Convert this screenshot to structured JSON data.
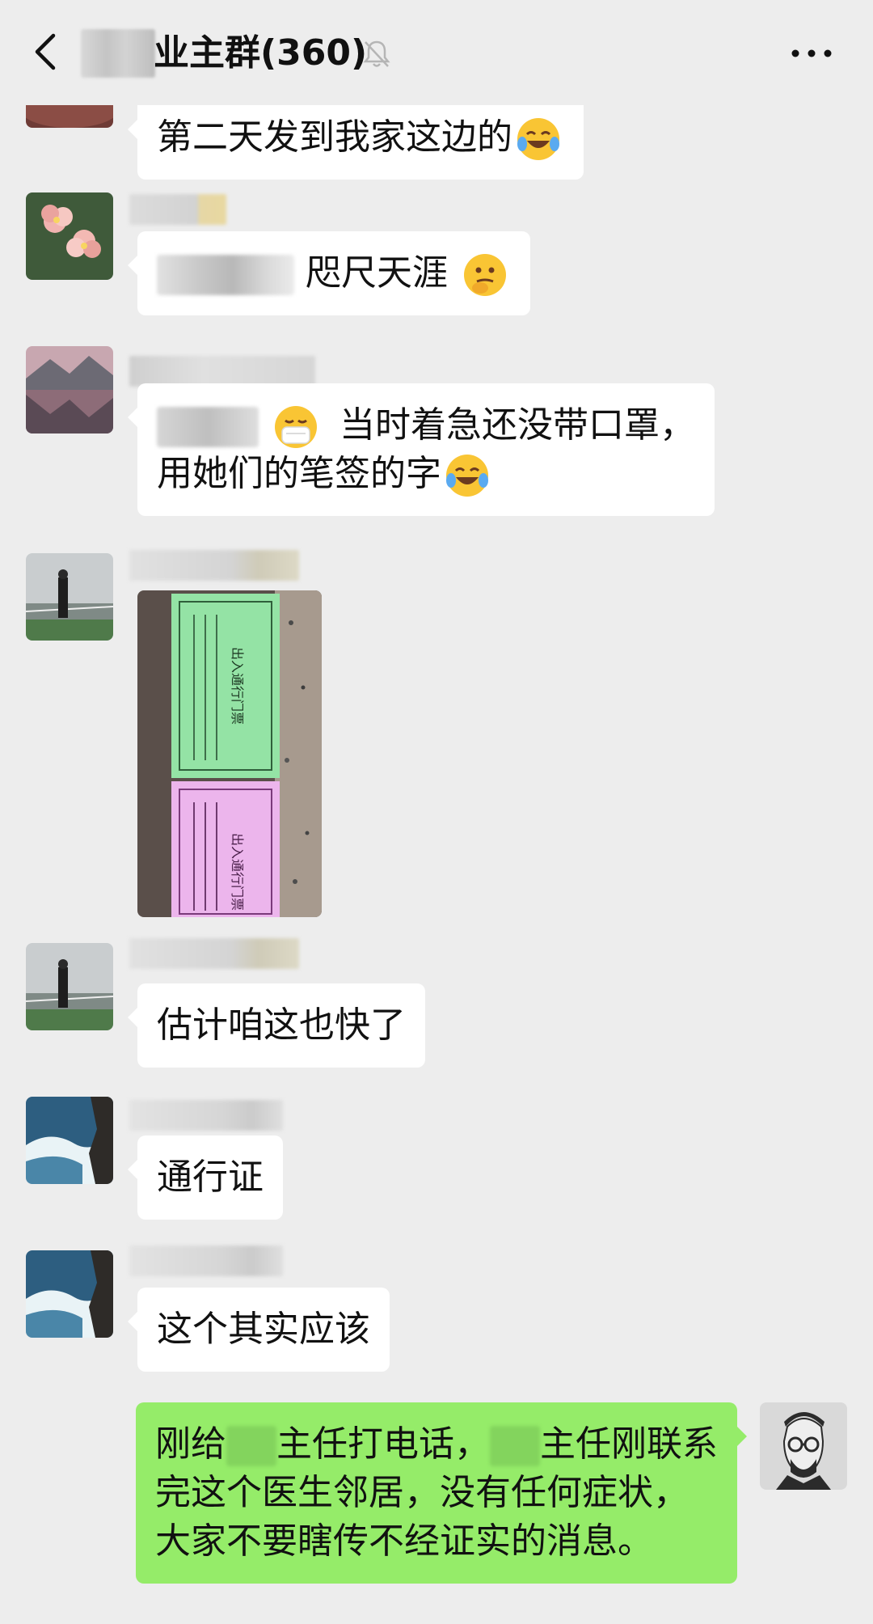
{
  "header": {
    "title": "业主群(360)",
    "back_icon": "chevron-left-icon",
    "mute_icon": "bell-muted-icon",
    "more_icon": "more-horizontal-icon"
  },
  "messages": [
    {
      "type": "text",
      "text": "第二天发到我家这边的",
      "emoji": "laughing-crying-emoji"
    },
    {
      "type": "text",
      "text": "咫尺天涯",
      "emoji": "thinking-emoji"
    },
    {
      "type": "text",
      "line1": "当时着急还没带口罩，",
      "line2": "用她们的笔签的字",
      "emoji1": "mask-face-emoji",
      "emoji2": "laughing-crying-emoji"
    },
    {
      "type": "image",
      "pass_title": "出入通行门票"
    },
    {
      "type": "text",
      "text": "估计咱这也快了"
    },
    {
      "type": "text",
      "text": "通行证"
    },
    {
      "type": "text",
      "text": "这个其实应该"
    },
    {
      "type": "text",
      "sender": "self",
      "line1_a": "刚给",
      "line1_b": "主任打电话，",
      "line1_c": "主任刚联系",
      "line2": "完这个医生邻居，没有任何症状，",
      "line3": "大家不要瞎传不经证实的消息。"
    }
  ],
  "colors": {
    "background": "#ededed",
    "incoming_bubble": "#ffffff",
    "outgoing_bubble": "#95ec69"
  }
}
